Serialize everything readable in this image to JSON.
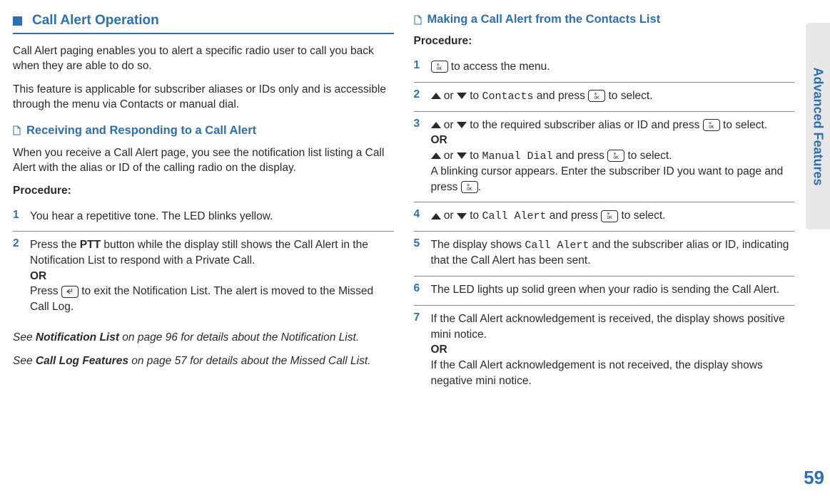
{
  "sideTab": "Advanced Features",
  "pageNumber": "59",
  "left": {
    "sectionTitle": "Call Alert Operation",
    "intro1": "Call Alert paging enables you to alert a specific radio user to call you back when they are able to do so.",
    "intro2": "This feature is applicable for subscriber aliases or IDs only and is accessible through the menu via Contacts or manual dial.",
    "sub1Title": "Receiving and Responding to a Call Alert",
    "sub1Intro": "When you receive a Call Alert page, you see the notification list listing a Call Alert with the alias or ID of the calling radio on the display.",
    "procedureLabel": "Procedure:",
    "steps": [
      {
        "num": "1",
        "text": "You hear a repetitive tone. The LED blinks yellow."
      },
      {
        "num": "2",
        "line1a": "Press the ",
        "ptt": "PTT",
        "line1b": " button while the display still shows the Call Alert in the Notification List to respond with a Private Call.",
        "or": "OR",
        "line2a": "Press ",
        "line2b": " to exit the Notification List. The alert is moved to the Missed Call Log."
      }
    ],
    "note1a": "See ",
    "note1bold": "Notification List",
    "note1b": " on page 96 for details about the Notification List.",
    "note2a": "See ",
    "note2bold": "Call Log Features",
    "note2b": " on page 57 for details about the Missed Call List."
  },
  "right": {
    "subTitle": "Making a Call Alert from the Contacts List",
    "procedureLabel": "Procedure:",
    "steps": {
      "s1": {
        "num": "1",
        "tail": " to access the menu."
      },
      "s2": {
        "num": "2",
        "mid1": " or ",
        "mid2": " to ",
        "contacts": "Contacts",
        "mid3": " and press ",
        "tail": " to select."
      },
      "s3": {
        "num": "3",
        "mid1": " or ",
        "mid2": " to the required subscriber alias or ID and press ",
        "tail1": " to select.",
        "or": "OR",
        "mid3": " or ",
        "mid4": " to ",
        "manual": "Manual Dial",
        "mid5": " and press ",
        "tail2": " to select.",
        "line3a": "A blinking cursor appears. Enter the subscriber ID you want to page and press ",
        "line3b": "."
      },
      "s4": {
        "num": "4",
        "mid1": " or ",
        "mid2": " to ",
        "callalert": "Call Alert",
        "mid3": " and press ",
        "tail": " to select."
      },
      "s5": {
        "num": "5",
        "a": "The display shows ",
        "callalert": "Call Alert",
        "b": " and the subscriber alias or ID, indicating that the Call Alert has been sent."
      },
      "s6": {
        "num": "6",
        "text": "The LED lights up solid green when your radio is sending the Call Alert."
      },
      "s7": {
        "num": "7",
        "a": "If the Call Alert acknowledgement is received, the display shows  positive mini notice.",
        "or": "OR",
        "b": "If the Call Alert acknowledgement is not received, the display shows  negative mini notice."
      }
    }
  }
}
